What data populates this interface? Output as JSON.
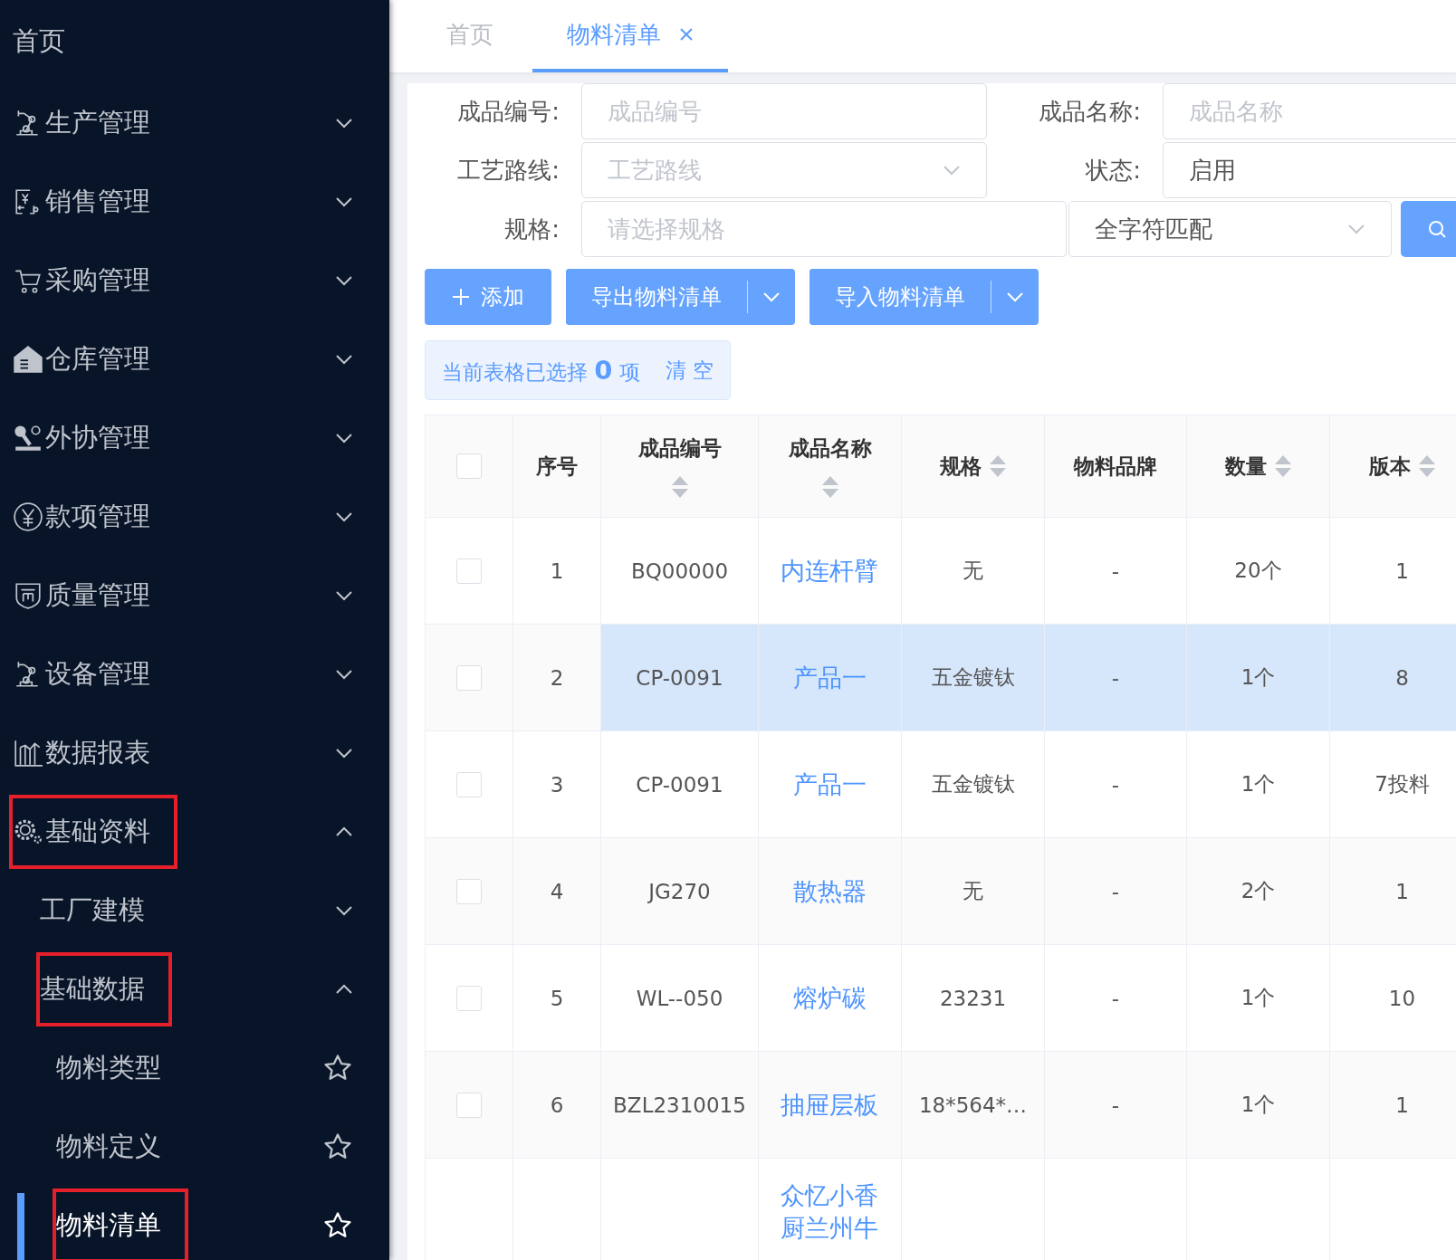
{
  "sidebar": {
    "items": [
      {
        "label": "首页",
        "kind": "link"
      },
      {
        "label": "生产管理",
        "kind": "group",
        "expanded": false
      },
      {
        "label": "销售管理",
        "kind": "group",
        "expanded": false
      },
      {
        "label": "采购管理",
        "kind": "group",
        "expanded": false
      },
      {
        "label": "仓库管理",
        "kind": "group",
        "expanded": false
      },
      {
        "label": "外协管理",
        "kind": "group",
        "expanded": false
      },
      {
        "label": "款项管理",
        "kind": "group",
        "expanded": false
      },
      {
        "label": "质量管理",
        "kind": "group",
        "expanded": false
      },
      {
        "label": "设备管理",
        "kind": "group",
        "expanded": false
      },
      {
        "label": "数据报表",
        "kind": "group",
        "expanded": false
      },
      {
        "label": "基础资料",
        "kind": "group",
        "expanded": true,
        "marked": true,
        "children": [
          {
            "label": "工厂建模",
            "kind": "group",
            "expanded": false
          },
          {
            "label": "基础数据",
            "kind": "group",
            "expanded": true,
            "marked": true,
            "children": [
              {
                "label": "物料类型",
                "kind": "leaf",
                "selected": false
              },
              {
                "label": "物料定义",
                "kind": "leaf",
                "selected": false
              },
              {
                "label": "物料清单",
                "kind": "leaf",
                "selected": true,
                "marked": true
              }
            ]
          }
        ]
      }
    ]
  },
  "tabs": [
    {
      "label": "首页",
      "selected": false,
      "closable": false
    },
    {
      "label": "物料清单",
      "selected": true,
      "closable": true
    }
  ],
  "filters": {
    "rows": [
      {
        "fields": [
          {
            "label": "成品编号:",
            "kind": "input",
            "placeholder": "成品编号"
          },
          {
            "label": "成品名称:",
            "kind": "input",
            "placeholder": "成品名称"
          }
        ]
      },
      {
        "fields": [
          {
            "label": "工艺路线:",
            "kind": "select",
            "placeholder": "工艺路线"
          },
          {
            "label": "状态:",
            "kind": "input",
            "value": "启用"
          }
        ]
      },
      {
        "fields": [
          {
            "label": "规格:",
            "kind": "input",
            "placeholder": "请选择规格"
          }
        ],
        "match_select": "全字符匹配",
        "search_button": true
      }
    ]
  },
  "actions": [
    {
      "label": "添加",
      "kind": "add"
    },
    {
      "label": "导出物料清单",
      "kind": "split"
    },
    {
      "label": "导入物料清单",
      "kind": "split"
    }
  ],
  "selection_info": {
    "text": "当前表格已选择 **0** 项",
    "clear_link": "清 空"
  },
  "table": {
    "select_all_checked": false,
    "columns": [
      {
        "label": "序号",
        "sortable": false
      },
      {
        "label": "成品编号",
        "sortable": true
      },
      {
        "label": "成品名称",
        "sortable": true
      },
      {
        "label": "规格",
        "sortable": true
      },
      {
        "label": "物料品牌",
        "sortable": false
      },
      {
        "label": "数量",
        "sortable": true
      },
      {
        "label": "版本",
        "sortable": true
      }
    ],
    "rows": [
      {
        "checked": false,
        "highlighted": false,
        "cells": [
          "1",
          "BQ00000",
          "内连杆臂",
          "无",
          "-",
          "20个",
          "1"
        ]
      },
      {
        "checked": false,
        "highlighted": true,
        "cells": [
          "2",
          "CP-0091",
          "产品一",
          "五金镀钛",
          "-",
          "1个",
          "8"
        ]
      },
      {
        "checked": false,
        "highlighted": false,
        "cells": [
          "3",
          "CP-0091",
          "产品一",
          "五金镀钛",
          "-",
          "1个",
          "7投料"
        ]
      },
      {
        "checked": false,
        "highlighted": false,
        "cells": [
          "4",
          "JG270",
          "散热器",
          "无",
          "-",
          "2个",
          "1"
        ]
      },
      {
        "checked": false,
        "highlighted": false,
        "cells": [
          "5",
          "WL--050",
          "熔炉碳",
          "23231",
          "-",
          "1个",
          "10"
        ]
      },
      {
        "checked": false,
        "highlighted": false,
        "cells": [
          "6",
          "BZL2310015",
          "抽屉层板",
          "18*564*…",
          "-",
          "1个",
          "1"
        ]
      },
      {
        "highlighted": false,
        "cells": [
          null,
          null,
          "众忆小香厨兰州牛",
          null,
          null,
          null,
          null
        ]
      }
    ]
  }
}
